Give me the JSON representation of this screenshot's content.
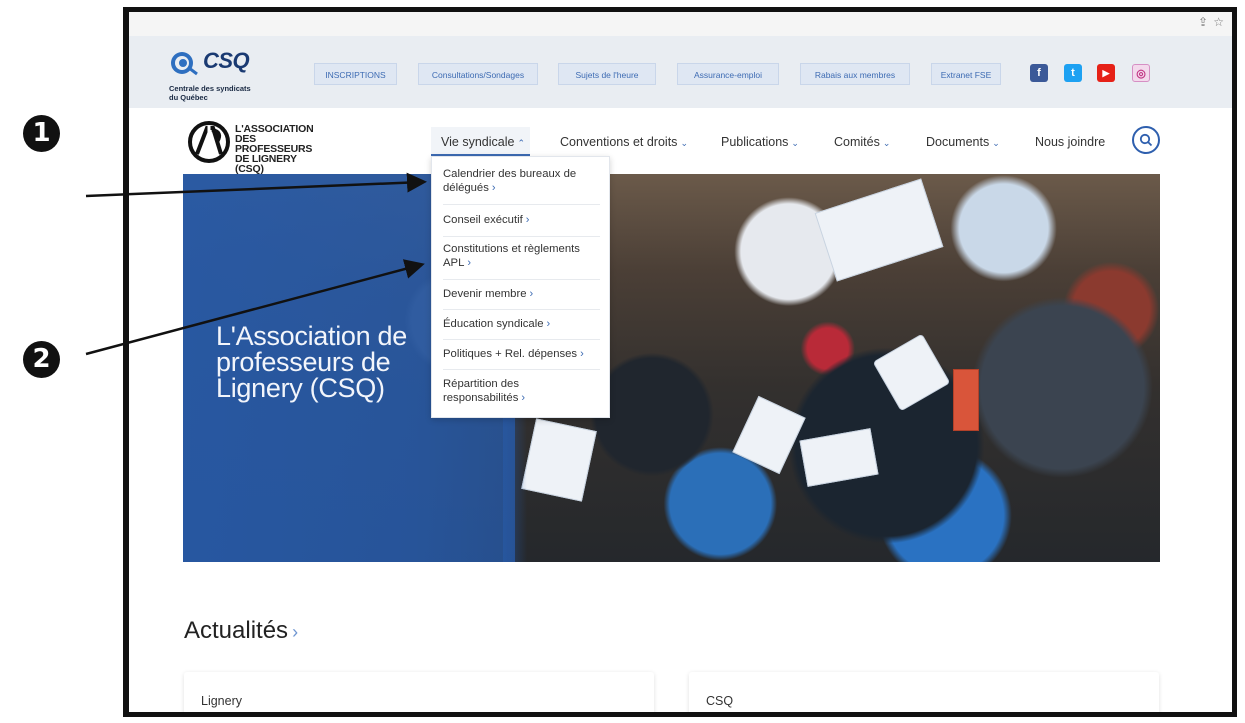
{
  "browser": {
    "share_icon": "share-icon",
    "bookmark_icon": "star-icon"
  },
  "csq": {
    "wordmark": "CSQ",
    "subtitle_line1": "Centrale des syndicats",
    "subtitle_line2": "du Québec"
  },
  "topbar_links": [
    "INSCRIPTIONS",
    "Consultations/Sondages",
    "Sujets de l'heure",
    "Assurance-emploi",
    "Rabais aux membres",
    "Extranet FSE"
  ],
  "social": {
    "facebook": "f",
    "twitter": "t",
    "youtube": "▶",
    "instagram": "◎"
  },
  "apl": {
    "line1": "L'ASSOCIATION",
    "line2": "DES PROFESSEURS",
    "line3": "DE LIGNERY (CSQ)"
  },
  "nav": {
    "vie_syndicale": "Vie syndicale",
    "conventions": "Conventions et droits",
    "publications": "Publications",
    "comites": "Comités",
    "documents": "Documents",
    "nous_joindre": "Nous joindre"
  },
  "dropdown": {
    "items": [
      "Calendrier des bureaux de délégués",
      "Conseil exécutif",
      "Constitutions et règlements APL",
      "Devenir membre",
      "Éducation syndicale",
      "Politiques + Rel. dépenses",
      "Répartition des responsabilités"
    ],
    "lines": {
      "i0a": "Calendrier des bureaux de",
      "i0b": "délégués",
      "i2a": "Constitutions et règlements",
      "i2b": "APL",
      "i6a": "Répartition des",
      "i6b": "responsabilités"
    }
  },
  "hero": {
    "line1": "L'Association de",
    "line2": "professeurs de",
    "line3": "Lignery (CSQ)"
  },
  "news": {
    "title": "Actualités",
    "cards": [
      "Lignery",
      "CSQ"
    ]
  },
  "annotations": {
    "marker1": "1",
    "marker2": "2"
  },
  "colors": {
    "accent": "#3d6bb3",
    "brand_blue": "#275aa8",
    "topbar_bg": "#e9edf2",
    "facebook": "#3b5998",
    "twitter": "#1da1f2",
    "youtube": "#e62117",
    "instagram": "#c13584"
  }
}
